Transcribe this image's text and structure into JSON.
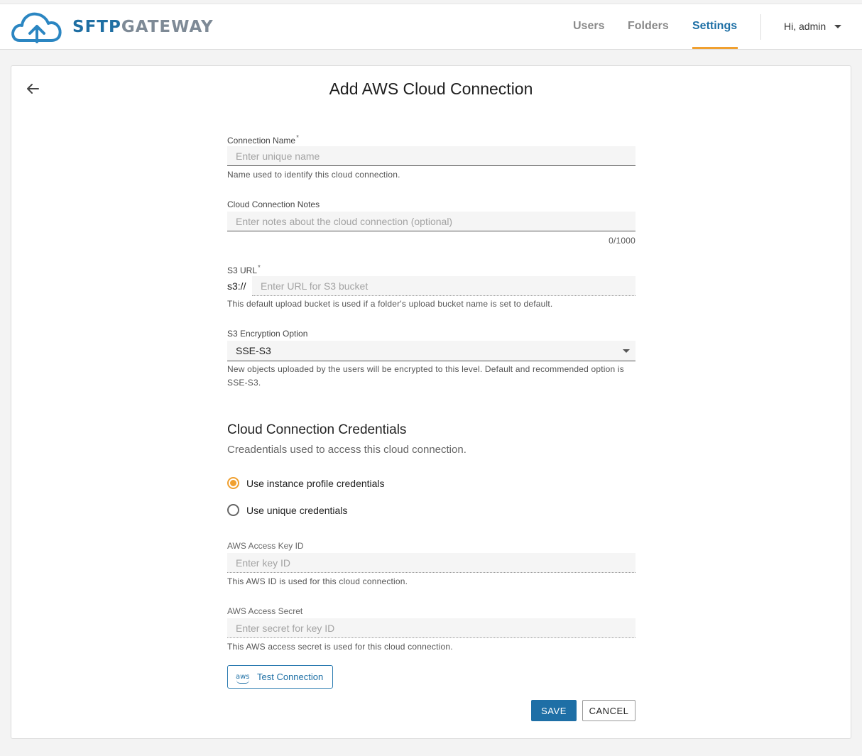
{
  "header": {
    "logo_primary": "SFTP",
    "logo_secondary": "GATEWAY",
    "nav": {
      "users": "Users",
      "folders": "Folders",
      "settings": "Settings"
    },
    "user_menu": "Hi, admin"
  },
  "page": {
    "title": "Add AWS Cloud Connection"
  },
  "form": {
    "connection_name": {
      "label": "Connection Name",
      "required_mark": "*",
      "placeholder": "Enter unique name",
      "hint": "Name used to identify this cloud connection."
    },
    "notes": {
      "label": "Cloud Connection Notes",
      "placeholder": "Enter notes about the cloud connection (optional)",
      "counter": "0/1000"
    },
    "s3_url": {
      "label": "S3 URL",
      "required_mark": "*",
      "prefix": "s3://",
      "placeholder": "Enter URL for S3 bucket",
      "hint": "This default upload bucket is used if a folder's upload bucket name is set to default."
    },
    "encryption": {
      "label": "S3 Encryption Option",
      "value": "SSE-S3",
      "hint": "New objects uploaded by the users will be encrypted to this level. Default and recommended option is SSE-S3."
    },
    "credentials": {
      "title": "Cloud Connection Credentials",
      "subtitle": "Creadentials used to access this cloud connection.",
      "options": [
        {
          "label": "Use instance profile credentials",
          "selected": true
        },
        {
          "label": "Use unique credentials",
          "selected": false
        }
      ],
      "access_key": {
        "label": "AWS Access Key ID",
        "placeholder": "Enter key ID",
        "hint": "This AWS ID is used for this cloud connection."
      },
      "access_secret": {
        "label": "AWS Access Secret",
        "placeholder": "Enter secret for key ID",
        "hint": "This AWS access secret is used for this cloud connection."
      }
    },
    "test_button": {
      "icon_text": "aws",
      "label": "Test Connection"
    },
    "save_label": "SAVE",
    "cancel_label": "CANCEL"
  },
  "colors": {
    "brand_blue": "#1e6fa6",
    "accent_orange": "#f0a030"
  }
}
